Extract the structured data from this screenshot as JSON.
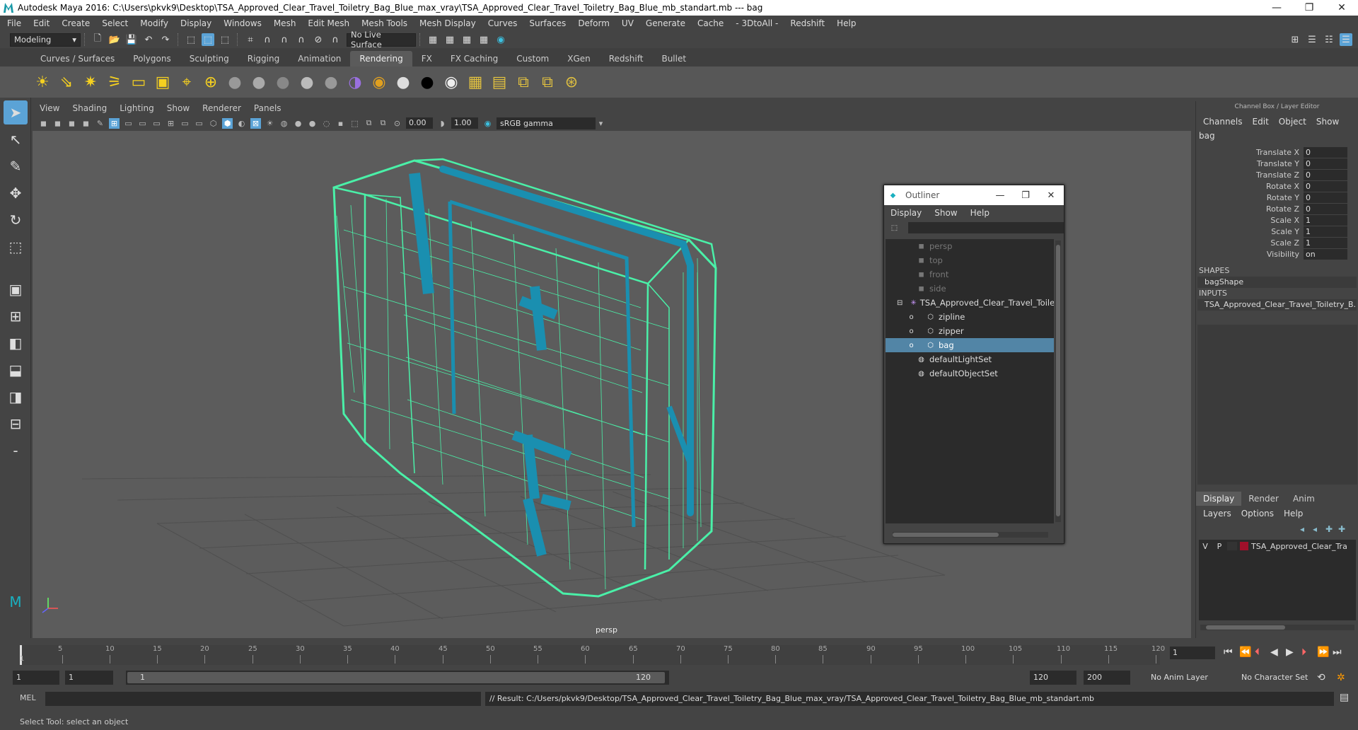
{
  "window": {
    "title": "Autodesk Maya 2016: C:\\Users\\pkvk9\\Desktop\\TSA_Approved_Clear_Travel_Toiletry_Bag_Blue_max_vray\\TSA_Approved_Clear_Travel_Toiletry_Bag_Blue_mb_standart.mb  ---  bag",
    "minimize": "—",
    "maximize": "❐",
    "close": "✕"
  },
  "menubar": [
    "File",
    "Edit",
    "Create",
    "Select",
    "Modify",
    "Display",
    "Windows",
    "Mesh",
    "Edit Mesh",
    "Mesh Tools",
    "Mesh Display",
    "Curves",
    "Surfaces",
    "Deform",
    "UV",
    "Generate",
    "Cache",
    "- 3DtoAll -",
    "Redshift",
    "Help"
  ],
  "statusline": {
    "mode": "Modeling",
    "live_surface": "No Live Surface"
  },
  "shelf_tabs": [
    "Curves / Surfaces",
    "Polygons",
    "Sculpting",
    "Rigging",
    "Animation",
    "Rendering",
    "FX",
    "FX Caching",
    "Custom",
    "XGen",
    "Redshift",
    "Bullet"
  ],
  "shelf_active": "Rendering",
  "viewport": {
    "menu": [
      "View",
      "Shading",
      "Lighting",
      "Show",
      "Renderer",
      "Panels"
    ],
    "exposure": "0.00",
    "gamma_value": "1.00",
    "color_space": "sRGB gamma",
    "camera": "persp"
  },
  "outliner": {
    "title": "Outliner",
    "menu": [
      "Display",
      "Show",
      "Help"
    ],
    "items": [
      {
        "label": "persp",
        "dim": true
      },
      {
        "label": "top",
        "dim": true
      },
      {
        "label": "front",
        "dim": true
      },
      {
        "label": "side",
        "dim": true
      },
      {
        "label": "TSA_Approved_Clear_Travel_Toiletr",
        "dim": false
      },
      {
        "label": "zipline",
        "dim": false
      },
      {
        "label": "zipper",
        "dim": false
      },
      {
        "label": "bag",
        "dim": false
      },
      {
        "label": "defaultLightSet",
        "dim": false
      },
      {
        "label": "defaultObjectSet",
        "dim": false
      }
    ]
  },
  "channel_box": {
    "title": "Channel Box / Layer Editor",
    "menu": [
      "Channels",
      "Edit",
      "Object",
      "Show"
    ],
    "object": "bag",
    "attributes": [
      {
        "label": "Translate X",
        "value": "0"
      },
      {
        "label": "Translate Y",
        "value": "0"
      },
      {
        "label": "Translate Z",
        "value": "0"
      },
      {
        "label": "Rotate X",
        "value": "0"
      },
      {
        "label": "Rotate Y",
        "value": "0"
      },
      {
        "label": "Rotate Z",
        "value": "0"
      },
      {
        "label": "Scale X",
        "value": "1"
      },
      {
        "label": "Scale Y",
        "value": "1"
      },
      {
        "label": "Scale Z",
        "value": "1"
      },
      {
        "label": "Visibility",
        "value": "on"
      }
    ],
    "shapes_header": "SHAPES",
    "shape": "bagShape",
    "inputs_header": "INPUTS",
    "input": "TSA_Approved_Clear_Travel_Toiletry_B..."
  },
  "layer_editor": {
    "tabs": [
      "Display",
      "Render",
      "Anim"
    ],
    "menu": [
      "Layers",
      "Options",
      "Help"
    ],
    "layer": {
      "v": "V",
      "p": "P",
      "name": "TSA_Approved_Clear_Tra",
      "color": "#a0102a"
    }
  },
  "timeline": {
    "ticks": [
      "5",
      "10",
      "15",
      "20",
      "25",
      "30",
      "35",
      "40",
      "45",
      "50",
      "55",
      "60",
      "65",
      "70",
      "75",
      "80",
      "85",
      "90",
      "95",
      "100",
      "105",
      "110",
      "115",
      "120"
    ],
    "start": "1",
    "current": "1"
  },
  "range": {
    "start": "1",
    "playback_start": "1",
    "slider_start": "1",
    "slider_end": "120",
    "playback_end": "120",
    "end": "200",
    "anim_layer": "No Anim Layer",
    "character_set": "No Character Set"
  },
  "command": {
    "lang": "MEL",
    "result": "// Result: C:/Users/pkvk9/Desktop/TSA_Approved_Clear_Travel_Toiletry_Bag_Blue_max_vray/TSA_Approved_Clear_Travel_Toiletry_Bag_Blue_mb_standart.mb"
  },
  "helpline": "Select Tool: select an object",
  "colors": {
    "wire": "#4af0a8",
    "accent": "#1a8fb0",
    "selection": "#5285a6"
  }
}
